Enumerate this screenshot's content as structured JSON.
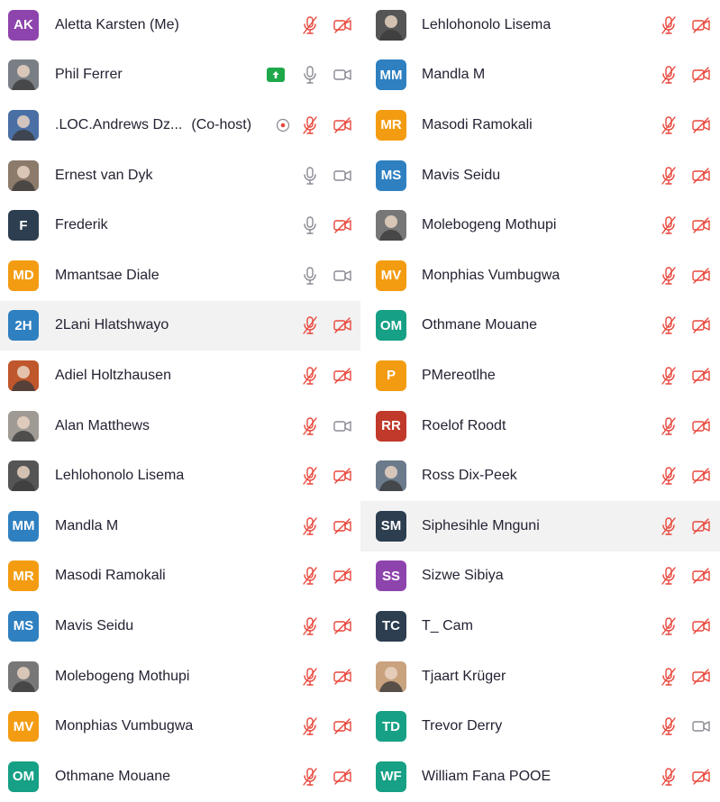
{
  "colors": {
    "mute_red": "#e8473c",
    "icon_gray": "#8a8a93",
    "share_green": "#1ea84a",
    "highlight_bg": "#f2f2f2"
  },
  "left_column": [
    {
      "name": "Aletta Karsten (Me)",
      "initials": "AK",
      "avatar_color": "#8e44ad",
      "photo": false,
      "mic": "muted",
      "video": "off"
    },
    {
      "name": "Phil Ferrer",
      "initials": "",
      "avatar_color": "#7a7f86",
      "photo": true,
      "mic": "on",
      "video": "on",
      "share_icon": "screen-share-icon"
    },
    {
      "name": ".LOC.Andrews Dz...",
      "cohost": "(Co-host)",
      "initials": "",
      "avatar_color": "#4a6fa5",
      "photo": true,
      "mic": "muted",
      "video": "off",
      "recording_icon": "record-icon"
    },
    {
      "name": "Ernest van Dyk",
      "initials": "",
      "avatar_color": "#8c7a6b",
      "photo": true,
      "mic": "on",
      "video": "on"
    },
    {
      "name": "Frederik",
      "initials": "F",
      "avatar_color": "#2c3e50",
      "photo": false,
      "mic": "on",
      "video": "off"
    },
    {
      "name": "Mmantsae Diale",
      "initials": "MD",
      "avatar_color": "#f39c12",
      "photo": false,
      "mic": "on",
      "video": "on"
    },
    {
      "name": "2Lani Hlatshwayo",
      "initials": "2H",
      "avatar_color": "#2f80c0",
      "photo": false,
      "mic": "muted",
      "video": "off",
      "highlight": true
    },
    {
      "name": "Adiel Holtzhausen",
      "initials": "",
      "avatar_color": "#c0562b",
      "photo": true,
      "mic": "muted",
      "video": "off"
    },
    {
      "name": "Alan Matthews",
      "initials": "",
      "avatar_color": "#a09a94",
      "photo": true,
      "mic": "muted",
      "video": "on"
    },
    {
      "name": "Lehlohonolo Lisema",
      "initials": "",
      "avatar_color": "#555555",
      "photo": true,
      "mic": "muted",
      "video": "off"
    },
    {
      "name": "Mandla M",
      "initials": "MM",
      "avatar_color": "#2f80c0",
      "photo": false,
      "mic": "muted",
      "video": "off"
    },
    {
      "name": "Masodi Ramokali",
      "initials": "MR",
      "avatar_color": "#f39c12",
      "photo": false,
      "mic": "muted",
      "video": "off"
    },
    {
      "name": "Mavis Seidu",
      "initials": "MS",
      "avatar_color": "#2f80c0",
      "photo": false,
      "mic": "muted",
      "video": "off"
    },
    {
      "name": "Molebogeng Mothupi",
      "initials": "",
      "avatar_color": "#777777",
      "photo": true,
      "mic": "muted",
      "video": "off"
    },
    {
      "name": "Monphias Vumbugwa",
      "initials": "MV",
      "avatar_color": "#f39c12",
      "photo": false,
      "mic": "muted",
      "video": "off"
    },
    {
      "name": "Othmane Mouane",
      "initials": "OM",
      "avatar_color": "#16a085",
      "photo": false,
      "mic": "muted",
      "video": "off"
    }
  ],
  "right_column": [
    {
      "name": "Lehlohonolo Lisema",
      "initials": "",
      "avatar_color": "#555555",
      "photo": true,
      "mic": "muted",
      "video": "off"
    },
    {
      "name": "Mandla M",
      "initials": "MM",
      "avatar_color": "#2f80c0",
      "photo": false,
      "mic": "muted",
      "video": "off"
    },
    {
      "name": "Masodi Ramokali",
      "initials": "MR",
      "avatar_color": "#f39c12",
      "photo": false,
      "mic": "muted",
      "video": "off"
    },
    {
      "name": "Mavis Seidu",
      "initials": "MS",
      "avatar_color": "#2f80c0",
      "photo": false,
      "mic": "muted",
      "video": "off"
    },
    {
      "name": "Molebogeng Mothupi",
      "initials": "",
      "avatar_color": "#777777",
      "photo": true,
      "mic": "muted",
      "video": "off"
    },
    {
      "name": "Monphias Vumbugwa",
      "initials": "MV",
      "avatar_color": "#f39c12",
      "photo": false,
      "mic": "muted",
      "video": "off"
    },
    {
      "name": "Othmane Mouane",
      "initials": "OM",
      "avatar_color": "#16a085",
      "photo": false,
      "mic": "muted",
      "video": "off"
    },
    {
      "name": "PMereotlhe",
      "initials": "P",
      "avatar_color": "#f39c12",
      "photo": false,
      "mic": "muted",
      "video": "off"
    },
    {
      "name": "Roelof Roodt",
      "initials": "RR",
      "avatar_color": "#c0392b",
      "photo": false,
      "mic": "muted",
      "video": "off"
    },
    {
      "name": "Ross Dix-Peek",
      "initials": "",
      "avatar_color": "#6b7b8c",
      "photo": true,
      "mic": "muted",
      "video": "off"
    },
    {
      "name": "Siphesihle Mnguni",
      "initials": "SM",
      "avatar_color": "#2c3e50",
      "photo": false,
      "mic": "muted",
      "video": "off",
      "highlight": true
    },
    {
      "name": "Sizwe Sibiya",
      "initials": "SS",
      "avatar_color": "#8e44ad",
      "photo": false,
      "mic": "muted",
      "video": "off"
    },
    {
      "name": "T_ Cam",
      "initials": "TC",
      "avatar_color": "#2c3e50",
      "photo": false,
      "mic": "muted",
      "video": "off"
    },
    {
      "name": "Tjaart Krüger",
      "initials": "",
      "avatar_color": "#c9a27e",
      "photo": true,
      "mic": "muted",
      "video": "off"
    },
    {
      "name": "Trevor Derry",
      "initials": "TD",
      "avatar_color": "#16a085",
      "photo": false,
      "mic": "muted",
      "video": "on"
    },
    {
      "name": "William Fana POOE",
      "initials": "WF",
      "avatar_color": "#16a085",
      "photo": false,
      "mic": "muted",
      "video": "off"
    }
  ]
}
